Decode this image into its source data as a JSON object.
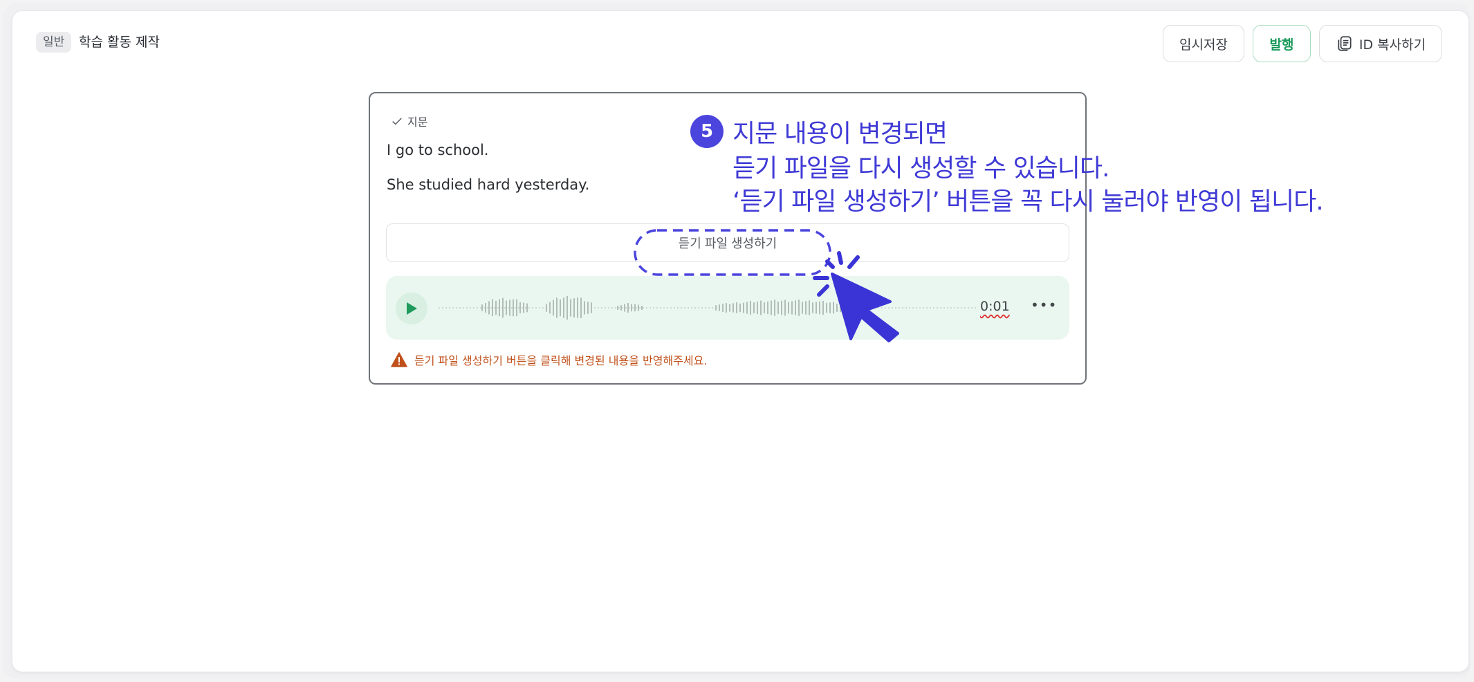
{
  "header": {
    "badge": "일반",
    "title": "학습 활동 제작",
    "buttons": {
      "temp_save": "임시저장",
      "publish": "발행",
      "copy_id": "ID 복사하기"
    }
  },
  "card": {
    "label": "지문",
    "sentences": [
      "I go to school.",
      "She studied hard yesterday."
    ],
    "generate_button": "듣기 파일 생성하기",
    "player": {
      "time": "0:01",
      "more": "•••"
    },
    "warning": "듣기 파일 생성하기 버튼을 클릭해 변경된 내용을 반영해주세요."
  },
  "annotation": {
    "step": "5",
    "lines": [
      "지문 내용이 변경되면",
      "듣기 파일을 다시 생성할 수 있습니다.",
      "‘듣기 파일 생성하기’ 버튼을 꼭 다시 눌러야 반영이 됩니다."
    ]
  },
  "colors": {
    "accent": "#4b45de",
    "publish": "#1b9a5b",
    "warning": "#c0501a",
    "player_bg": "#eaf7f0"
  }
}
